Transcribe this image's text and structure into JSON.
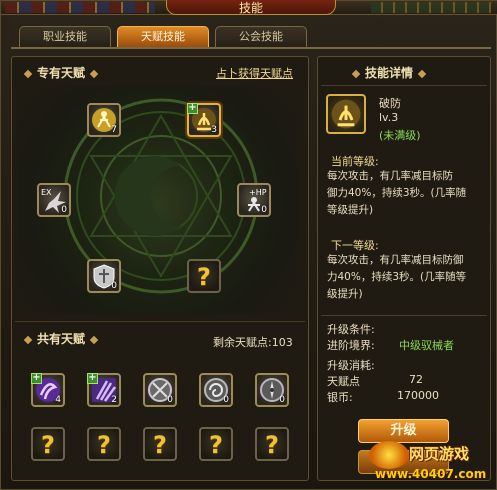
{
  "window": {
    "title": "技能"
  },
  "tabs": [
    {
      "label": "职业技能",
      "active": false
    },
    {
      "label": "天赋技能",
      "active": true
    },
    {
      "label": "公会技能",
      "active": false
    }
  ],
  "exclusive": {
    "title": "专有天赋",
    "link": "占卜获得天赋点",
    "skills": [
      {
        "name": "glow-figure",
        "count": "7",
        "plus": false
      },
      {
        "name": "break-defense",
        "count": "3",
        "plus": true,
        "selected": true
      },
      {
        "name": "ex-burst",
        "count": "0",
        "plus": false
      },
      {
        "name": "hp-boost",
        "count": "0",
        "plus": false
      },
      {
        "name": "shield",
        "count": "0",
        "plus": false
      },
      {
        "name": "unknown",
        "count": "",
        "plus": false
      }
    ]
  },
  "shared": {
    "title": "共有天赋",
    "remain_label": "剩余天赋点:",
    "remain_value": "103",
    "row1": [
      {
        "name": "purple-sigil",
        "count": "4",
        "plus": true
      },
      {
        "name": "purple-claw",
        "count": "2",
        "plus": true
      },
      {
        "name": "grey-cross",
        "count": "0",
        "plus": false
      },
      {
        "name": "grey-swirl",
        "count": "0",
        "plus": false
      },
      {
        "name": "grey-compass",
        "count": "0",
        "plus": false
      }
    ],
    "row2_count": 5,
    "qmark": "?"
  },
  "detail": {
    "title": "技能详情",
    "skill_name": "破防",
    "level": "lv.3",
    "status": "(未满级)",
    "current_label": "当前等级:",
    "current_desc_lines": [
      "每次攻击，有几率减目标防",
      "御力40%，持续3秒。(几率随",
      "等级提升)"
    ],
    "next_label": "下一等级:",
    "next_desc_lines": [
      "每次攻击，有几率减目标防御",
      "力40%，持续3秒。(几率随等",
      "级提升)"
    ],
    "cond_label": "升级条件:",
    "realm_label": "进阶境界:",
    "realm_value": "中级驭械者",
    "cost_label": "升级消耗:",
    "talent_label": "天赋点",
    "talent_value": "72",
    "silver_label": "银币:",
    "silver_value": "170000"
  },
  "buttons": {
    "upgrade": "升级"
  },
  "watermark": {
    "top": "网页游戏",
    "bottom": "www.40407.com"
  },
  "colors": {
    "accent": "#e08a24",
    "gold": "#f2c230",
    "green": "#8ad850"
  }
}
